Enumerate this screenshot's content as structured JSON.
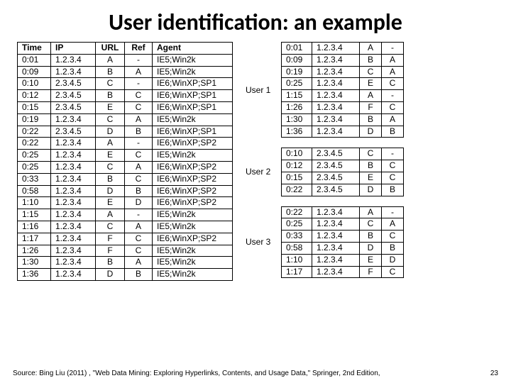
{
  "title": "User identification: an example",
  "main_table": {
    "headers": [
      "Time",
      "IP",
      "URL",
      "Ref",
      "Agent"
    ],
    "rows": [
      [
        "0:01",
        "1.2.3.4",
        "A",
        "-",
        "IE5;Win2k"
      ],
      [
        "0:09",
        "1.2.3.4",
        "B",
        "A",
        "IE5;Win2k"
      ],
      [
        "0:10",
        "2.3.4.5",
        "C",
        "-",
        "IE6;WinXP;SP1"
      ],
      [
        "0:12",
        "2.3.4.5",
        "B",
        "C",
        "IE6;WinXP;SP1"
      ],
      [
        "0:15",
        "2.3.4.5",
        "E",
        "C",
        "IE6;WinXP;SP1"
      ],
      [
        "0:19",
        "1.2.3.4",
        "C",
        "A",
        "IE5;Win2k"
      ],
      [
        "0:22",
        "2.3.4.5",
        "D",
        "B",
        "IE6;WinXP;SP1"
      ],
      [
        "0:22",
        "1.2.3.4",
        "A",
        "-",
        "IE6;WinXP;SP2"
      ],
      [
        "0:25",
        "1.2.3.4",
        "E",
        "C",
        "IE5;Win2k"
      ],
      [
        "0:25",
        "1.2.3.4",
        "C",
        "A",
        "IE6;WinXP;SP2"
      ],
      [
        "0:33",
        "1.2.3.4",
        "B",
        "C",
        "IE6;WinXP;SP2"
      ],
      [
        "0:58",
        "1.2.3.4",
        "D",
        "B",
        "IE6;WinXP;SP2"
      ],
      [
        "1:10",
        "1.2.3.4",
        "E",
        "D",
        "IE6;WinXP;SP2"
      ],
      [
        "1:15",
        "1.2.3.4",
        "A",
        "-",
        "IE5;Win2k"
      ],
      [
        "1:16",
        "1.2.3.4",
        "C",
        "A",
        "IE5;Win2k"
      ],
      [
        "1:17",
        "1.2.3.4",
        "F",
        "C",
        "IE6;WinXP;SP2"
      ],
      [
        "1:26",
        "1.2.3.4",
        "F",
        "C",
        "IE5;Win2k"
      ],
      [
        "1:30",
        "1.2.3.4",
        "B",
        "A",
        "IE5;Win2k"
      ],
      [
        "1:36",
        "1.2.3.4",
        "D",
        "B",
        "IE5;Win2k"
      ]
    ]
  },
  "groups": [
    {
      "label": "User 1",
      "rows": [
        [
          "0:01",
          "1.2.3.4",
          "A",
          "-"
        ],
        [
          "0:09",
          "1.2.3.4",
          "B",
          "A"
        ],
        [
          "0:19",
          "1.2.3.4",
          "C",
          "A"
        ],
        [
          "0:25",
          "1.2.3.4",
          "E",
          "C"
        ],
        [
          "1:15",
          "1.2.3.4",
          "A",
          "-"
        ],
        [
          "1:26",
          "1.2.3.4",
          "F",
          "C"
        ],
        [
          "1:30",
          "1.2.3.4",
          "B",
          "A"
        ],
        [
          "1:36",
          "1.2.3.4",
          "D",
          "B"
        ]
      ]
    },
    {
      "label": "User 2",
      "rows": [
        [
          "0:10",
          "2.3.4.5",
          "C",
          "-"
        ],
        [
          "0:12",
          "2.3.4.5",
          "B",
          "C"
        ],
        [
          "0:15",
          "2.3.4.5",
          "E",
          "C"
        ],
        [
          "0:22",
          "2.3.4.5",
          "D",
          "B"
        ]
      ]
    },
    {
      "label": "User 3",
      "rows": [
        [
          "0:22",
          "1.2.3.4",
          "A",
          "-"
        ],
        [
          "0:25",
          "1.2.3.4",
          "C",
          "A"
        ],
        [
          "0:33",
          "1.2.3.4",
          "B",
          "C"
        ],
        [
          "0:58",
          "1.2.3.4",
          "D",
          "B"
        ],
        [
          "1:10",
          "1.2.3.4",
          "E",
          "D"
        ],
        [
          "1:17",
          "1.2.3.4",
          "F",
          "C"
        ]
      ]
    }
  ],
  "source": "Source: Bing Liu (2011) , \"Web Data Mining: Exploring Hyperlinks, Contents, and Usage Data,\" Springer, 2nd Edition,",
  "page_number": "23"
}
